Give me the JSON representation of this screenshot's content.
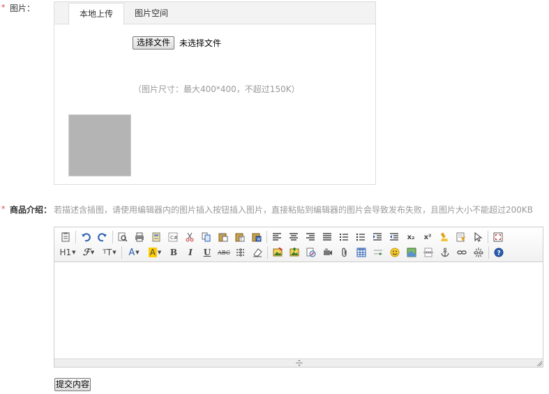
{
  "image_field": {
    "required_mark": "*",
    "label": "图片：",
    "tabs": [
      {
        "label": "本地上传"
      },
      {
        "label": "图片空间"
      }
    ],
    "file_button": "选择文件",
    "no_file_text": "未选择文件",
    "size_hint": "（图片尺寸：最大400*400，不超过150K）"
  },
  "description_field": {
    "required_mark": "*",
    "label": "商品介绍：",
    "hint": "若描述含插图，请使用编辑器内的图片插入按钮插入图片，直接粘贴到编辑器的图片会导致发布失败，且图片大小不能超过200KB"
  },
  "editor": {
    "toolbar": {
      "h1_label": "H1",
      "bold": "B",
      "italic": "I",
      "underline": "U",
      "strike": "ABC",
      "sub": "x₂",
      "sup": "x²"
    },
    "icons": [
      "source-icon",
      "undo-icon",
      "redo-icon",
      "preview-icon",
      "print-icon",
      "template-icon",
      "code-icon",
      "cut-icon",
      "copy-icon",
      "paste-icon",
      "paste-plain-icon",
      "paste-word-icon",
      "align-left-icon",
      "align-center-icon",
      "align-right-icon",
      "align-justify-icon",
      "ordered-list-icon",
      "unordered-list-icon",
      "indent-icon",
      "outdent-icon",
      "subscript-icon",
      "superscript-icon",
      "clear-format-icon",
      "select-all-icon",
      "pointer-icon",
      "fullscreen-icon",
      "heading-icon",
      "font-family-icon",
      "font-size-icon",
      "font-color-icon",
      "highlight-icon",
      "bold-icon",
      "italic-icon",
      "underline-icon",
      "strikethrough-icon",
      "line-height-icon",
      "eraser-icon",
      "image-icon",
      "multi-image-icon",
      "flash-icon",
      "media-icon",
      "attachment-icon",
      "table-icon",
      "hr-icon",
      "emoticon-icon",
      "map-icon",
      "page-break-icon",
      "anchor-icon",
      "link-icon",
      "unlink-icon",
      "help-icon"
    ]
  },
  "submit_label": "提交内容",
  "colors": {
    "required": "#e4393c",
    "hint_text": "#999999",
    "thumb_placeholder": "#b4b4b4",
    "highlight": "#ffcc00",
    "font_color": "#2a5db0"
  }
}
